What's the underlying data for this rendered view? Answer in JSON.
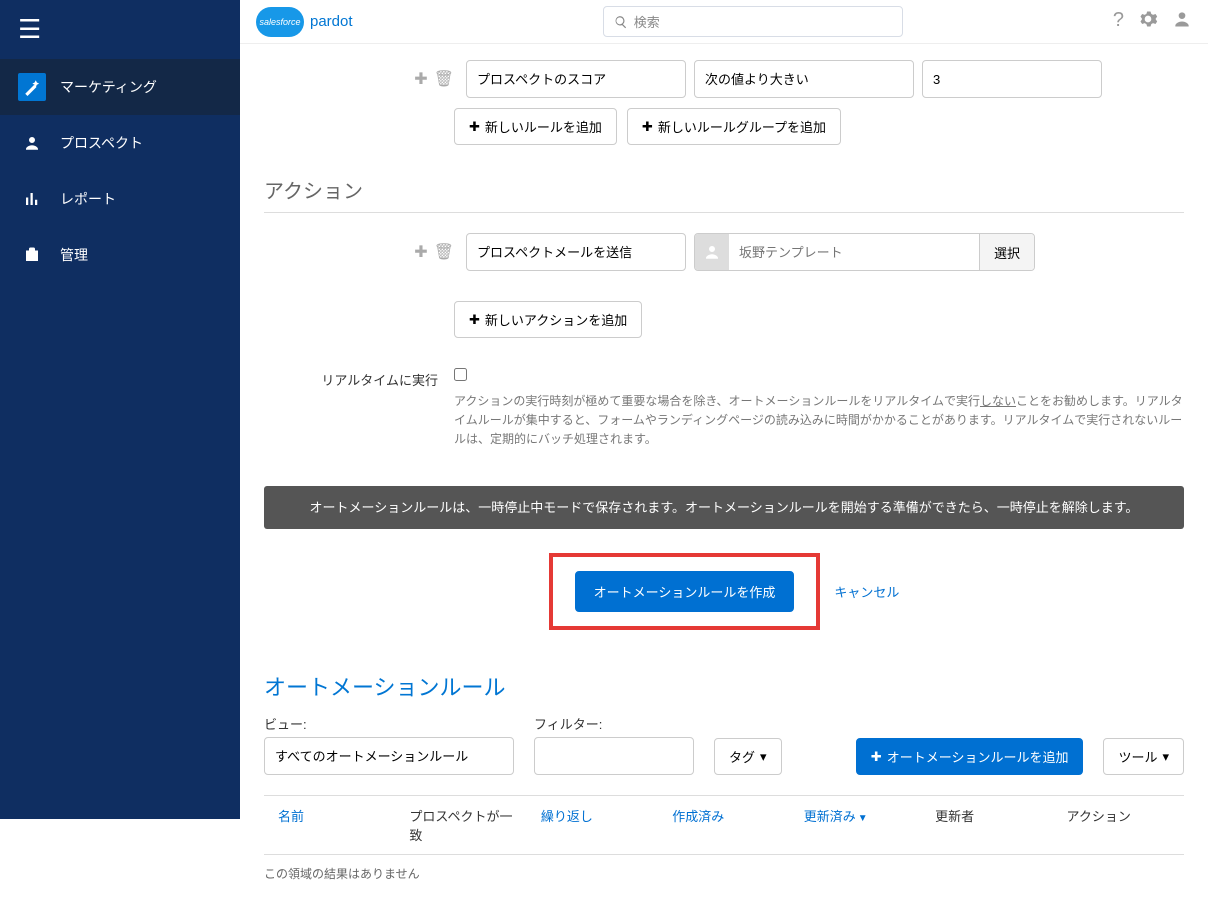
{
  "topbar": {
    "logo_cloud": "salesforce",
    "logo_text": "pardot",
    "search_placeholder": "検索"
  },
  "sidebar": {
    "items": [
      {
        "label": "マーケティング"
      },
      {
        "label": "プロスペクト"
      },
      {
        "label": "レポート"
      },
      {
        "label": "管理"
      }
    ]
  },
  "rules": {
    "field_select": "プロスペクトのスコア",
    "operator_select": "次の値より大きい",
    "value_input": "3",
    "add_rule_label": "新しいルールを追加",
    "add_group_label": "新しいルールグループを追加"
  },
  "actions": {
    "title": "アクション",
    "action_select": "プロスペクトメールを送信",
    "template_placeholder": "坂野テンプレート",
    "select_btn": "選択",
    "add_action_label": "新しいアクションを追加"
  },
  "realtime": {
    "label": "リアルタイムに実行",
    "help_pre": "アクションの実行時刻が極めて重要な場合を除き、オートメーションルールをリアルタイムで実行",
    "help_underline": "しない",
    "help_post": "ことをお勧めします。リアルタイムルールが集中すると、フォームやランディングページの読み込みに時間がかかることがあります。リアルタイムで実行されないルールは、定期的にバッチ処理されます。"
  },
  "info_bar": "オートメーションルールは、一時停止中モードで保存されます。オートメーションルールを開始する準備ができたら、一時停止を解除します。",
  "submit": {
    "create_btn": "オートメーションルールを作成",
    "cancel": "キャンセル"
  },
  "list": {
    "title": "オートメーションルール",
    "view_label": "ビュー:",
    "view_select": "すべてのオートメーションルール",
    "filter_label": "フィルター:",
    "tag_btn": "タグ",
    "add_btn": "オートメーションルールを追加",
    "tools_btn": "ツール",
    "columns": {
      "name": "名前",
      "match": "プロスペクトが一致",
      "repeat": "繰り返し",
      "created": "作成済み",
      "updated": "更新済み",
      "updater": "更新者",
      "action": "アクション"
    },
    "no_results": "この領域の結果はありません"
  }
}
